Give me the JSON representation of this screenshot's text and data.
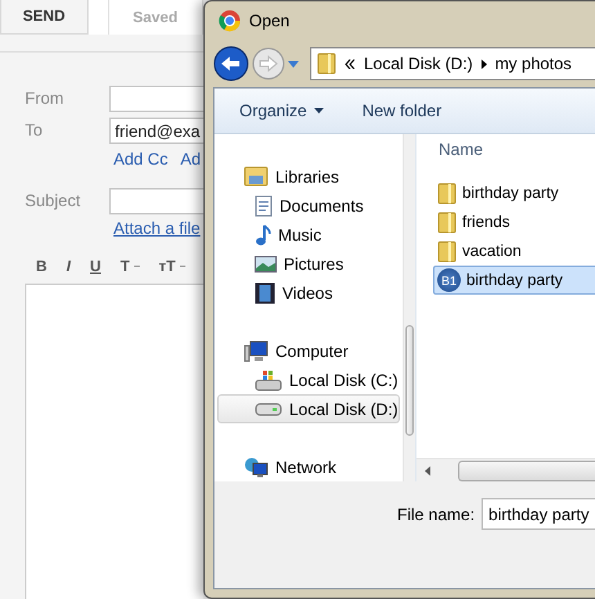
{
  "compose": {
    "send_button": "SEND",
    "saved_tab": "Saved",
    "fields": [
      {
        "label": "From",
        "kind": "input"
      },
      {
        "label": "To",
        "kind": "input",
        "value": "friend@exa"
      },
      {
        "label": "Subject",
        "kind": "input"
      }
    ],
    "cc_links": [
      "Add Cc",
      "Ad"
    ],
    "attach_link": "Attach a file",
    "format_buttons": [
      {
        "label": "B",
        "kind": "bold"
      },
      {
        "label": "I",
        "kind": "italic"
      },
      {
        "label": "U",
        "kind": "underline"
      },
      {
        "label": "T",
        "kind": "color"
      },
      {
        "label": "ᴛT",
        "kind": "size"
      }
    ]
  },
  "dialog": {
    "title": "Open",
    "path": [
      "Local Disk (D:)",
      "my photos"
    ],
    "toolbar": [
      {
        "label": "Organize",
        "kind": "menu"
      },
      {
        "label": "New folder",
        "kind": "button"
      }
    ],
    "nav": [
      {
        "label": "Libraries",
        "kind": "library",
        "selected": false,
        "children": [
          {
            "label": "Documents",
            "kind": "documents",
            "selected": false
          },
          {
            "label": "Music",
            "kind": "music",
            "selected": false
          },
          {
            "label": "Pictures",
            "kind": "pictures",
            "selected": false
          },
          {
            "label": "Videos",
            "kind": "videos",
            "selected": false
          }
        ]
      },
      {
        "label": "Computer",
        "kind": "computer",
        "selected": false,
        "children": [
          {
            "label": "Local Disk (C:)",
            "kind": "system-drive",
            "selected": false
          },
          {
            "label": "Local Disk (D:)",
            "kind": "drive",
            "selected": true
          }
        ]
      },
      {
        "label": "Network",
        "kind": "network",
        "selected": false
      }
    ],
    "column": "Name",
    "files": [
      {
        "name": "birthday party",
        "kind": "folder",
        "selected": false
      },
      {
        "name": "friends",
        "kind": "folder",
        "selected": false
      },
      {
        "name": "vacation",
        "kind": "folder",
        "selected": false
      },
      {
        "name": "birthday party",
        "kind": "image",
        "badge": "B1",
        "selected": true
      }
    ],
    "file_name_label": "File name:",
    "file_name": "birthday party"
  }
}
